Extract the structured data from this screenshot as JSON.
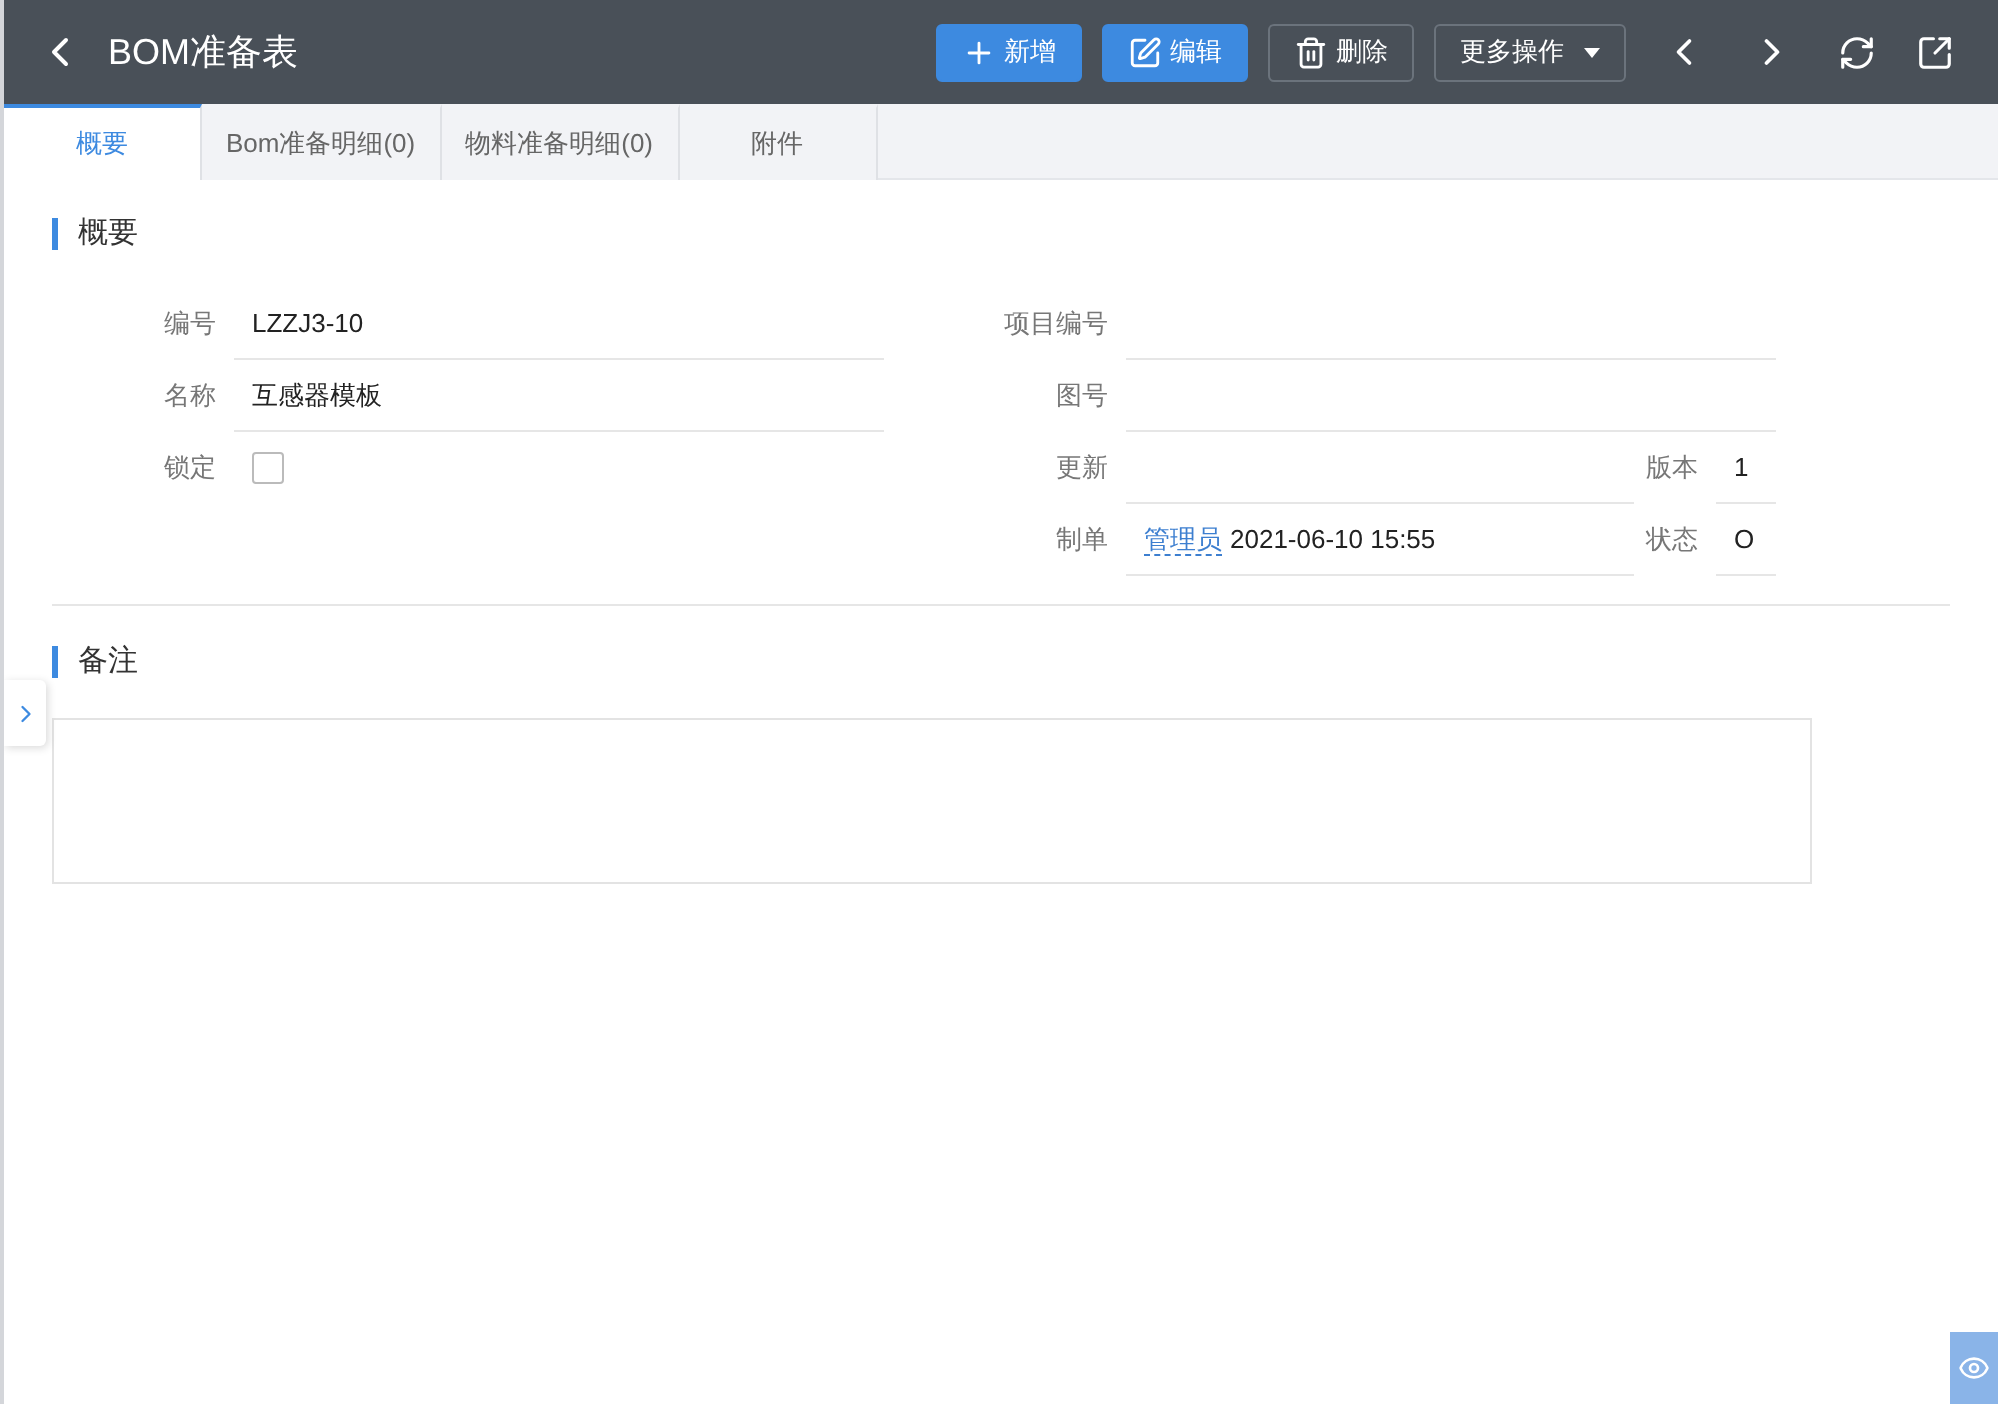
{
  "header": {
    "title": "BOM准备表",
    "buttons": [
      {
        "label": "新增",
        "kind": "primary"
      },
      {
        "label": "编辑",
        "kind": "primary"
      },
      {
        "label": "删除",
        "kind": "outline"
      },
      {
        "label": "更多操作",
        "kind": "dropdown"
      }
    ]
  },
  "tabs": [
    {
      "label": "概要",
      "selected": true
    },
    {
      "label": "Bom准备明细(0)",
      "selected": false
    },
    {
      "label": "物料准备明细(0)",
      "selected": false
    },
    {
      "label": "附件",
      "selected": false
    }
  ],
  "summary": {
    "title": "概要",
    "rows": [
      {
        "left": {
          "label": "编号",
          "value": "LZZJ3-10"
        },
        "right": {
          "label": "项目编号"
        }
      },
      {
        "left": {
          "label": "名称",
          "value": "互感器模板"
        },
        "right": {
          "label": "图号"
        }
      },
      {
        "left": {
          "label": "锁定",
          "kind": "checkbox",
          "checked": false
        },
        "right": {
          "label": "更新",
          "extra": {
            "label": "版本",
            "value": "1"
          }
        }
      },
      {
        "right": {
          "label": "制单",
          "link": "管理员",
          "value": "2021-06-10 15:55",
          "extra": {
            "label": "状态",
            "value": "O"
          }
        }
      }
    ]
  },
  "notes": {
    "title": "备注"
  }
}
